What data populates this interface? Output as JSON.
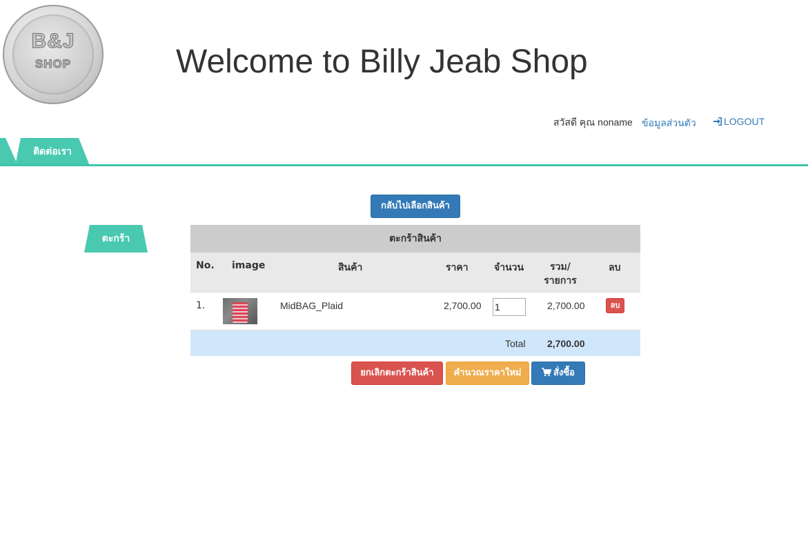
{
  "header": {
    "logo_text_top": "B&J",
    "logo_text_bottom": "SHOP",
    "title": "Welcome to Billy Jeab Shop"
  },
  "userbar": {
    "greeting": "สวัสดี คุณ noname",
    "profile_label": "ข้อมูลส่วนตัว",
    "logout_label": "LOGOUT",
    "logout_icon": "sign-in-icon"
  },
  "nav": {
    "tabs": [
      {
        "label": ""
      },
      {
        "label": "ติดต่อเรา"
      },
      {
        "label": "ตะกร้า"
      }
    ],
    "accent_color": "#48c9b0"
  },
  "actions": {
    "back_label": "กลับไปเลือกสินค้า",
    "cancel_label": "ยกเลิกตะกร้าสินค้า",
    "recalc_label": "คำนวณราคาใหม่",
    "order_label": "สั่งซื้อ",
    "order_icon": "shopping-cart-icon"
  },
  "cart": {
    "caption": "ตะกร้าสินค้า",
    "columns": {
      "no": "No.",
      "image": "image",
      "name": "สินค้า",
      "price": "ราคา",
      "qty": "จำนวน",
      "sum": "รวม/รายการ",
      "delete": "ลบ"
    },
    "rows": [
      {
        "no": "1.",
        "name": "MidBAG_Plaid",
        "price": "2,700.00",
        "qty": "1",
        "sum": "2,700.00",
        "delete_label": "ลบ"
      }
    ],
    "total_label": "Total",
    "total_value": "2,700.00"
  }
}
